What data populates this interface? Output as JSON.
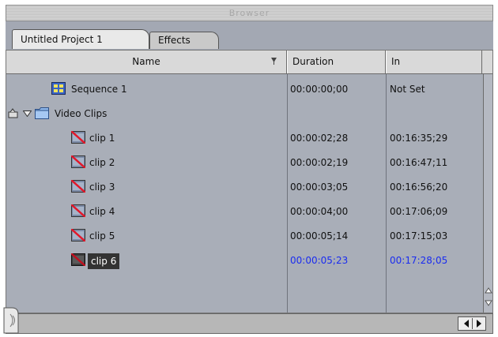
{
  "window": {
    "title": "Browser"
  },
  "tabs": [
    {
      "label": "Untitled Project 1",
      "active": true
    },
    {
      "label": "Effects",
      "active": false
    }
  ],
  "columns": {
    "name": "Name",
    "duration": "Duration",
    "in": "In"
  },
  "rows": [
    {
      "type": "sequence",
      "name": "Sequence 1",
      "duration": "00:00:00;00",
      "in": "Not Set"
    },
    {
      "type": "bin",
      "name": "Video Clips",
      "duration": "",
      "in": ""
    },
    {
      "type": "clip",
      "name": "clip 1",
      "duration": "00:00:02;28",
      "in": "00:16:35;29"
    },
    {
      "type": "clip",
      "name": "clip 2",
      "duration": "00:00:02;19",
      "in": "00:16:47;11"
    },
    {
      "type": "clip",
      "name": "clip 3",
      "duration": "00:00:03;05",
      "in": "00:16:56;20"
    },
    {
      "type": "clip",
      "name": "clip 4",
      "duration": "00:00:04;00",
      "in": "00:17:06;09"
    },
    {
      "type": "clip",
      "name": "clip 5",
      "duration": "00:00:05;14",
      "in": "00:17:15;03"
    },
    {
      "type": "clip",
      "name": "clip 6",
      "duration": "00:00:05;23",
      "in": "00:17:28;05",
      "selected": true
    }
  ],
  "colors": {
    "selection_text": "#1a2cf0",
    "list_bg": "#a9aeb8"
  },
  "icons": {
    "sequence": "sequence-icon",
    "bin": "folder-icon",
    "clip": "offline-clip-icon"
  }
}
